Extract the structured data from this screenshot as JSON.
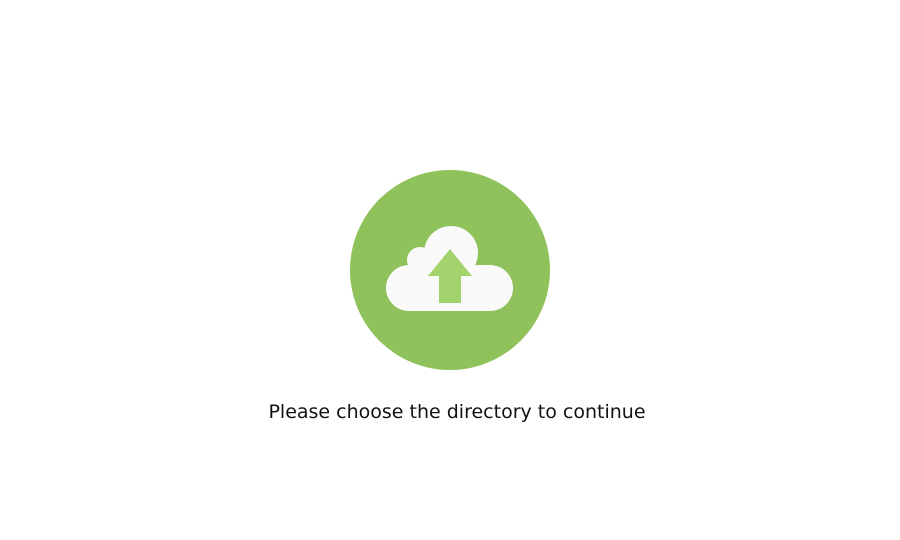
{
  "upload": {
    "icon": "cloud-upload-icon",
    "prompt": "Please choose the directory to continue"
  },
  "colors": {
    "circle": "#8fc25b",
    "cloud": "#fafafa",
    "arrow": "#a2d36d",
    "text": "#111111",
    "background": "#ffffff"
  }
}
